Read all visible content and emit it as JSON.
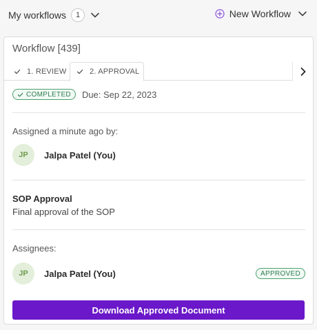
{
  "header": {
    "my_workflows_label": "My workflows",
    "my_workflows_count": "1",
    "new_workflow_label": "New Workflow"
  },
  "workflow": {
    "title": "Workflow [439]",
    "tabs": [
      {
        "label": "1. REVIEW",
        "checked": true,
        "active": false
      },
      {
        "label": "2. APPROVAL",
        "checked": true,
        "active": true
      }
    ],
    "status": "COMPLETED",
    "due": "Due: Sep 22, 2023",
    "assigned_label": "Assigned a minute ago by:",
    "assigner": {
      "initials": "JP",
      "name": "Jalpa Patel (You)"
    },
    "task_title": "SOP Approval",
    "task_description": "Final approval of the SOP",
    "assignees_label": "Assignees:",
    "assignees": [
      {
        "initials": "JP",
        "name": "Jalpa Patel (You)",
        "status": "APPROVED"
      }
    ],
    "download_label": "Download Approved Document"
  },
  "colors": {
    "primary": "#6a18c9",
    "success_border": "#4aa06b",
    "success_text": "#2f7d4f",
    "avatar_bg": "#e3efda",
    "avatar_text": "#6e9a4e",
    "accent_icon": "#8a4fd8"
  },
  "icons": {
    "my_workflows_toggle": "chevron-down-icon",
    "new_workflow": "plus-circle-icon",
    "new_workflow_toggle": "chevron-down-icon",
    "tab_done": "check-icon",
    "tabs_scroll": "chevron-right-icon"
  }
}
